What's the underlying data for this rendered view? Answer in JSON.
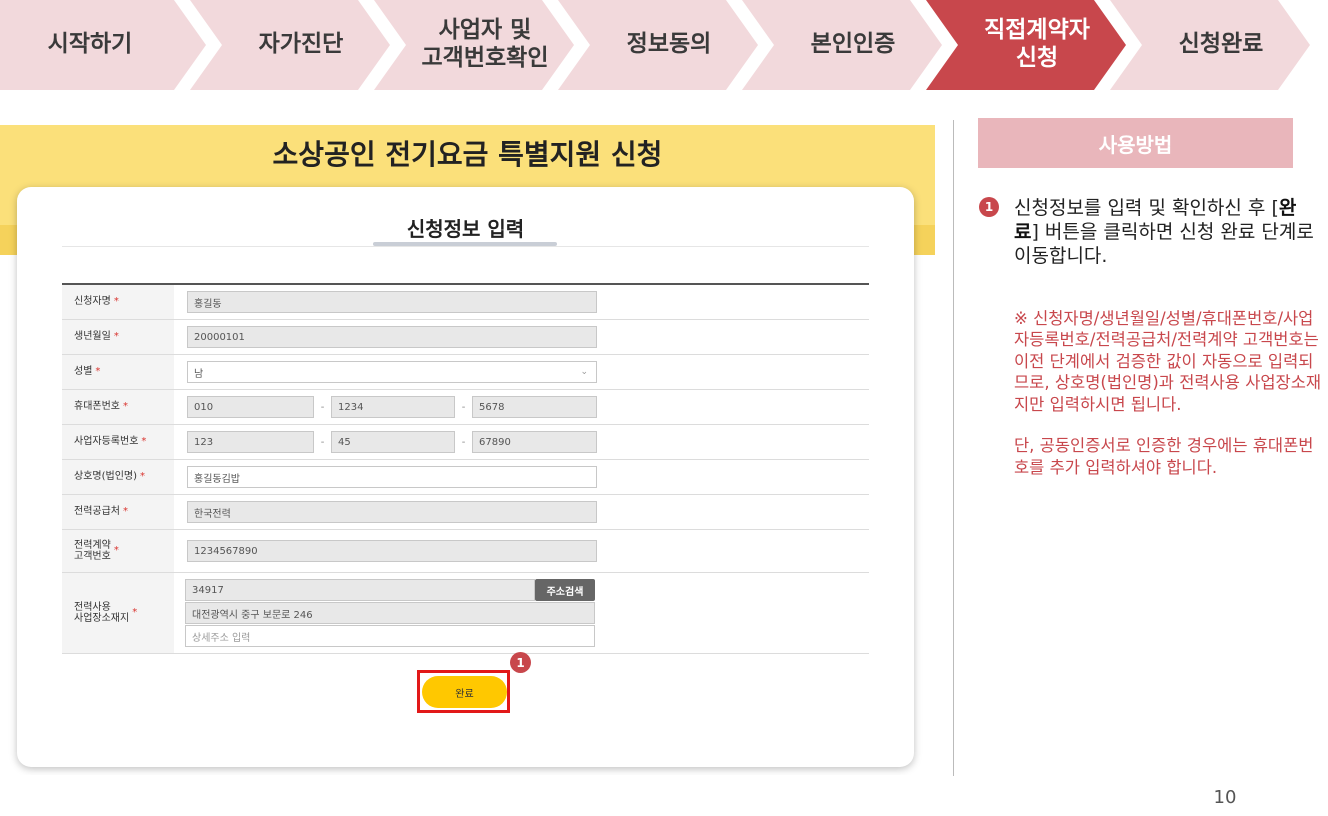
{
  "steps": [
    {
      "label": "시작하기",
      "active": false
    },
    {
      "label": "자가진단",
      "active": false
    },
    {
      "label": "사업자 및\n고객번호확인",
      "active": false
    },
    {
      "label": "정보동의",
      "active": false
    },
    {
      "label": "본인인증",
      "active": false
    },
    {
      "label": "직접계약자\n신청",
      "active": true
    },
    {
      "label": "신청완료",
      "active": false
    }
  ],
  "page_title": "소상공인 전기요금 특별지원 신청",
  "card_title": "신청정보 입력",
  "form": {
    "required_mark": "*",
    "applicant_name": {
      "label": "신청자명",
      "value": "홍길동"
    },
    "birth_date": {
      "label": "생년월일",
      "value": "20000101"
    },
    "gender": {
      "label": "성별",
      "value": "남"
    },
    "phone": {
      "label": "휴대폰번호",
      "parts": [
        "010",
        "1234",
        "5678"
      ]
    },
    "business_reg": {
      "label": "사업자등록번호",
      "parts": [
        "123",
        "45",
        "67890"
      ]
    },
    "company_name": {
      "label": "상호명(법인명)",
      "value": "홍길동김밥"
    },
    "power_supplier": {
      "label": "전력공급처",
      "value": "한국전력"
    },
    "customer_number": {
      "label": "전력계약\n고객번호",
      "value": "1234567890"
    },
    "address": {
      "label": "전력사용\n사업장소재지",
      "zipcode": "34917",
      "search_button": "주소검색",
      "road_address": "대전광역시 중구 보문로 246",
      "detail_placeholder": "상세주소 입력"
    },
    "separator": "-"
  },
  "done_button": "완료",
  "callout_number": "1",
  "sidebar": {
    "header": "사용방법",
    "step_number": "1",
    "step_text_before": "신청정보를 입력 및 확인하신 후 [",
    "step_text_bold": "완료",
    "step_text_after": "] 버튼을 클릭하면 신청 완료 단계로 이동합니다.",
    "note1": "※ 신청자명/생년월일/성별/휴대폰번호/사업자등록번호/전력공급처/전력계약 고객번호는 이전 단계에서 검증한 값이 자동으로 입력되므로, 상호명(법인명)과 전력사용 사업장소재지만 입력하시면 됩니다.",
    "note2": "단, 공동인증서로 인증한 경우에는 휴대폰번호를 추가 입력하셔야 합니다."
  },
  "page_number": "10",
  "colors": {
    "accent": "#c8474c",
    "step_bg": "#f2d9dc",
    "banner": "#fbe07a",
    "button": "#ffc800",
    "highlight_box": "#e21818"
  }
}
